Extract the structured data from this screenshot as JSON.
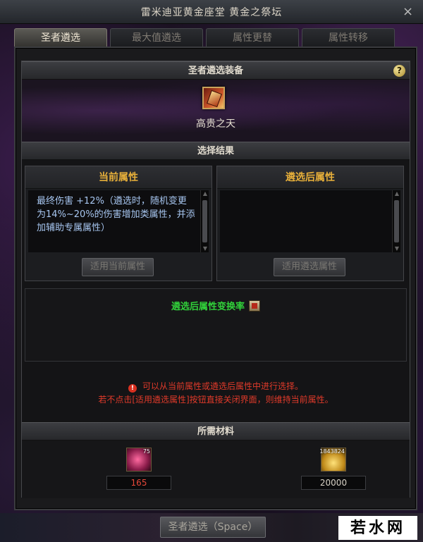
{
  "window": {
    "title": "雷米迪亚黄金座堂 黄金之祭坛",
    "close_glyph": "×"
  },
  "tabs": [
    {
      "label": "圣者遴选",
      "active": true
    },
    {
      "label": "最大值遴选",
      "active": false
    },
    {
      "label": "属性更替",
      "active": false
    },
    {
      "label": "属性转移",
      "active": false
    }
  ],
  "equipment_section": {
    "header": "圣者遴选装备",
    "help": "?",
    "item_name": "高贵之天"
  },
  "result_section": {
    "header": "选择结果"
  },
  "current_panel": {
    "title": "当前属性",
    "text_lines": [
      "最终伤害 +12%（遴选时，随机变更",
      "为14%~20%的伤害增加类属性，并添",
      "加辅助专属属性）"
    ],
    "button": "适用当前属性"
  },
  "after_panel": {
    "title": "遴选后属性",
    "text_lines": [],
    "button": "适用遴选属性"
  },
  "conversion": {
    "title": "遴选后属性变换率"
  },
  "notice": {
    "icon": "!",
    "line1": "可以从当前属性或遴选后属性中进行选择。",
    "line2": "若不点击[适用遴选属性]按钮直接关闭界面，则维持当前属性。"
  },
  "materials": {
    "header": "所需材料",
    "items": [
      {
        "icon": "pink-gem-icon",
        "stack": "75",
        "value": "165",
        "color": "#e8483a"
      },
      {
        "icon": "gold-coins-icon",
        "stack": "1843824",
        "value": "20000",
        "color": "#d8d2c6"
      }
    ]
  },
  "bottom_button": "圣者遴选（Space）",
  "watermark": "若水网",
  "colors": {
    "accent_gold": "#e8b03a",
    "green": "#31d33a",
    "red": "#e03a2a",
    "blue_text": "#a7c6f0"
  }
}
